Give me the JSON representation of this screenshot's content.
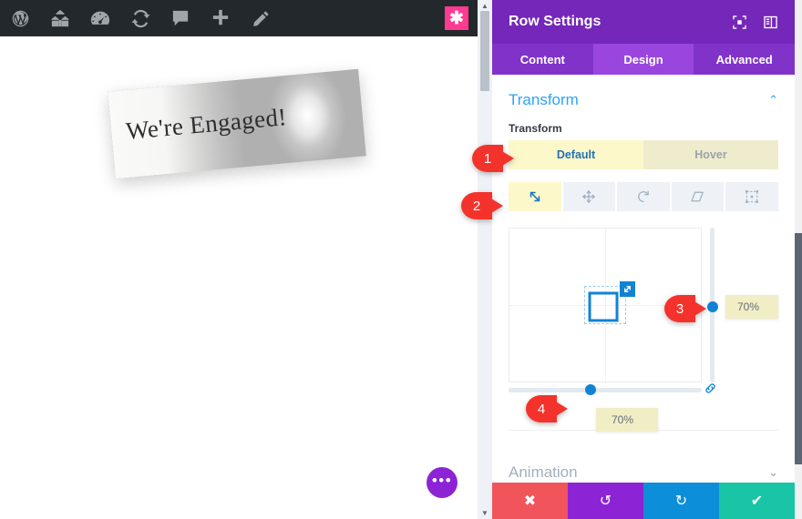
{
  "adminbar": {
    "items": [
      {
        "name": "wordpress-logo-icon",
        "label": "WordPress"
      },
      {
        "name": "site-home-icon",
        "label": "Site"
      },
      {
        "name": "dashboard-gauge-icon",
        "label": "Dashboard"
      },
      {
        "name": "updates-refresh-icon",
        "label": "Updates"
      },
      {
        "name": "comments-bubble-icon",
        "label": "Comments"
      },
      {
        "name": "new-plus-icon",
        "label": "New"
      },
      {
        "name": "edit-pencil-icon",
        "label": "Edit"
      }
    ],
    "accent_badge": {
      "name": "divi-asterisk-icon",
      "glyph": "✱",
      "color": "#ff3a91"
    },
    "background_color": "#23282d"
  },
  "canvas": {
    "photo_card": {
      "headline": "We're Engaged!"
    },
    "fab": {
      "label": "•••"
    }
  },
  "panel": {
    "title": "Row Settings",
    "header_icons": [
      {
        "name": "fullscreen-target-icon"
      },
      {
        "name": "panel-layout-icon"
      }
    ],
    "tabs": [
      {
        "label": "Content",
        "active": false
      },
      {
        "label": "Design",
        "active": true
      },
      {
        "label": "Advanced",
        "active": false
      }
    ],
    "sections": {
      "transform": {
        "heading": "Transform",
        "collapsed": false,
        "chevron": "⌃",
        "field_label": "Transform",
        "state_toggle": {
          "options": [
            {
              "label": "Default",
              "selected": true
            },
            {
              "label": "Hover",
              "selected": false
            }
          ]
        },
        "modes": [
          {
            "name": "scale-transform-icon",
            "active": true
          },
          {
            "name": "translate-move-icon",
            "active": false
          },
          {
            "name": "rotate-transform-icon",
            "active": false
          },
          {
            "name": "skew-transform-icon",
            "active": false
          },
          {
            "name": "transform-origin-icon",
            "active": false
          }
        ],
        "scale_x_value": "70%",
        "scale_y_value": "70%",
        "link_axes_icon": "link-chain-icon"
      },
      "animation": {
        "heading": "Animation",
        "collapsed": true,
        "chevron": "⌄"
      }
    },
    "footer_buttons": [
      {
        "name": "cancel-button",
        "glyph": "✖",
        "color": "#f2545b"
      },
      {
        "name": "undo-button",
        "glyph": "↺",
        "color": "#8c24d6"
      },
      {
        "name": "redo-button",
        "glyph": "↻",
        "color": "#0c8ed9"
      },
      {
        "name": "save-button",
        "glyph": "✔",
        "color": "#19c5a5"
      }
    ],
    "colors": {
      "header": "#7427b8",
      "tabs_bar": "#8133c9",
      "tab_active": "#9a46de",
      "section_title": "#2ea3f2",
      "highlight_yellow": "#fcf8ca"
    }
  },
  "markers": [
    {
      "number": "1"
    },
    {
      "number": "2"
    },
    {
      "number": "3"
    },
    {
      "number": "4"
    }
  ]
}
